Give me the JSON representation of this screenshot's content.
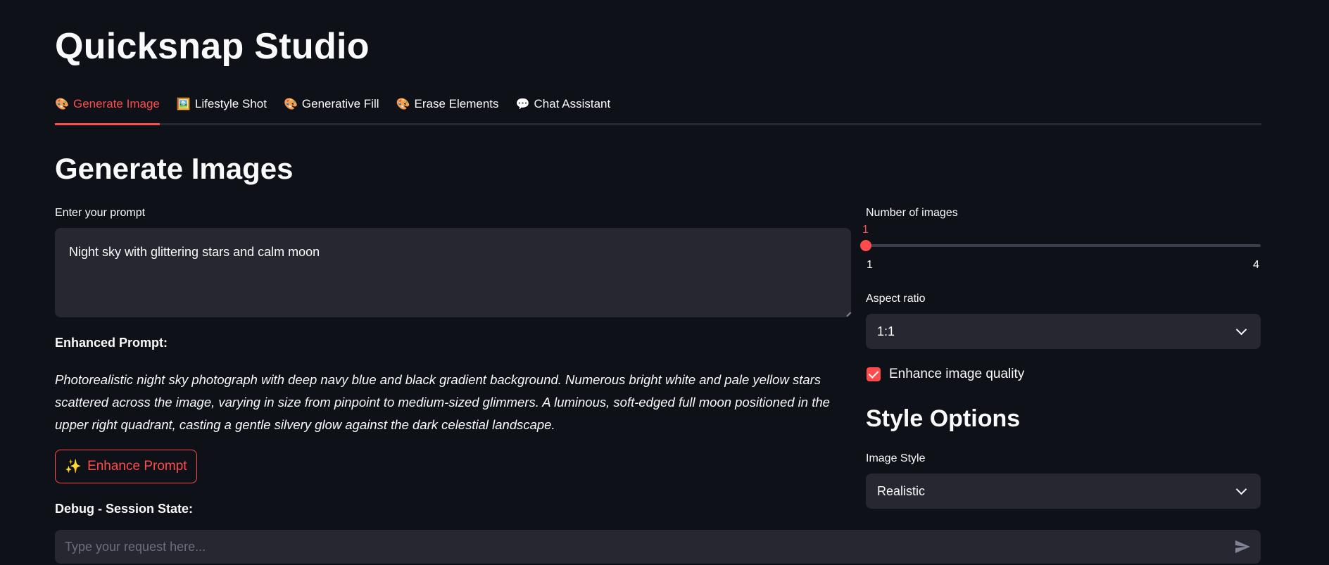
{
  "app": {
    "title": "Quicksnap Studio"
  },
  "tabs": [
    {
      "icon": "🎨",
      "label": "Generate Image",
      "active": true
    },
    {
      "icon": "🖼️",
      "label": "Lifestyle Shot",
      "active": false
    },
    {
      "icon": "🎨",
      "label": "Generative Fill",
      "active": false
    },
    {
      "icon": "🎨",
      "label": "Erase Elements",
      "active": false
    },
    {
      "icon": "💬",
      "label": "Chat Assistant",
      "active": false
    }
  ],
  "main": {
    "section_title": "Generate Images",
    "prompt_label": "Enter your prompt",
    "prompt_value": "Night sky with glittering stars and calm moon",
    "enhanced_label": "Enhanced Prompt:",
    "enhanced_text": "Photorealistic night sky photograph with deep navy blue and black gradient background. Numerous bright white and pale yellow stars scattered across the image, varying in size from pinpoint to medium-sized glimmers. A luminous, soft-edged full moon positioned in the upper right quadrant, casting a gentle silvery glow against the dark celestial landscape.",
    "enhance_button": {
      "icon": "✨",
      "label": "Enhance Prompt"
    },
    "debug_label": "Debug - Session State:"
  },
  "settings": {
    "num_images_label": "Number of images",
    "num_images_value": "1",
    "num_images_min": "1",
    "num_images_max": "4",
    "num_images_fraction": 0,
    "aspect_label": "Aspect ratio",
    "aspect_value": "1:1",
    "enhance_quality_label": "Enhance image quality",
    "enhance_quality_checked": true,
    "style_title": "Style Options",
    "image_style_label": "Image Style",
    "image_style_value": "Realistic"
  },
  "chat": {
    "placeholder": "Type your request here..."
  },
  "colors": {
    "accent": "#ff4b4b",
    "background": "#0e1117",
    "surface": "#262730",
    "text": "#fafafa"
  }
}
